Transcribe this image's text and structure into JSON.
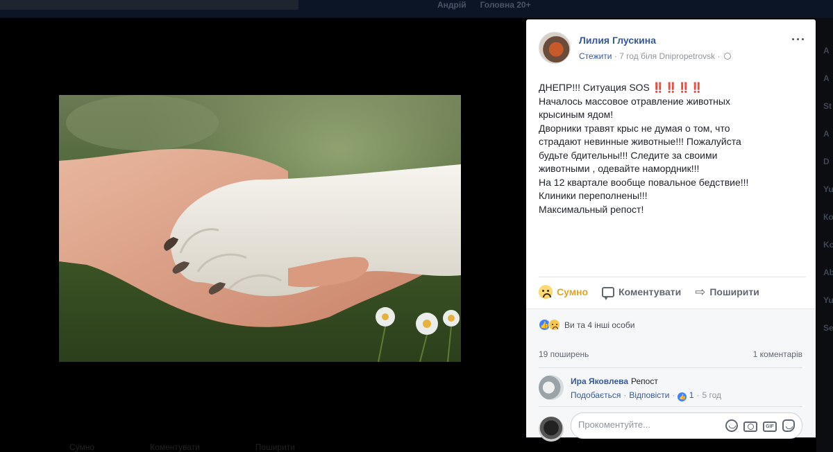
{
  "background": {
    "nav": [
      "Андрій",
      "Головна 20+"
    ],
    "right_column_letters": [
      "А",
      "А",
      "St",
      "А",
      "D",
      "Yu",
      "Ко",
      "Kc",
      "Ab",
      "Yu",
      "Se"
    ],
    "bottom_actions": [
      "Сумно",
      "Коментувати",
      "Поширити"
    ]
  },
  "post": {
    "author": "Лилия Глускина",
    "follow": "Стежити",
    "time": "7 год",
    "location_prefix": "біля",
    "location": "Dnipropetrovsk",
    "text_lines": [
      "ДНЕПР!!! Ситуация SOS",
      "Началось массовое отравление животных",
      "крысиным ядом!",
      "Дворники травят крыс не думая о том, что",
      "страдают невинные животные!!! Пожалуйста",
      "будьте бдительны!!! Следите за своими",
      "животными , одевайте намордник!!!",
      "На 12 квартале вообще повальное бедствие!!!",
      "Клиники переполнены!!!",
      "Максимальный репост!"
    ],
    "sos_marks": "‼️‼️‼️‼️"
  },
  "actions": {
    "react": "Сумно",
    "comment": "Коментувати",
    "share": "Поширити"
  },
  "reactions_summary": "Ви та 4 інші особи",
  "stats": {
    "shares": "19 поширень",
    "comments": "1 коментарів"
  },
  "comment": {
    "author": "Ира Яковлева",
    "text": "Репост",
    "like": "Подобається",
    "reply": "Відповісти",
    "likes_count": "1",
    "time": "5 год"
  },
  "composer": {
    "placeholder": "Прокоментуйте..."
  },
  "colors": {
    "link": "#365899",
    "sad_reaction": "#e0a422",
    "like_blue": "#4080ff"
  }
}
